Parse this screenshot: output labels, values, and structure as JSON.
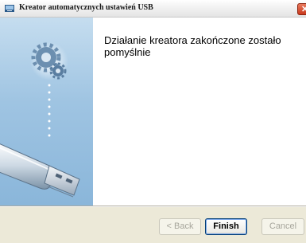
{
  "window": {
    "title": "Kreator automatycznych ustawień USB",
    "close_glyph": "✕"
  },
  "main": {
    "heading": "Działanie kreatora zakończone zostało pomyślnie"
  },
  "buttons": {
    "back_label": "< Back",
    "finish_label": "Finish",
    "cancel_label": "Cancel"
  },
  "icons": {
    "title": "usb-wizard-app-icon",
    "gears": "gears-icon",
    "usb": "usb-flash-drive-icon"
  },
  "colors": {
    "side_panel_top": "#c5ddef",
    "side_panel_bottom": "#8ab6da",
    "dialog_bg": "#ece9d8"
  }
}
